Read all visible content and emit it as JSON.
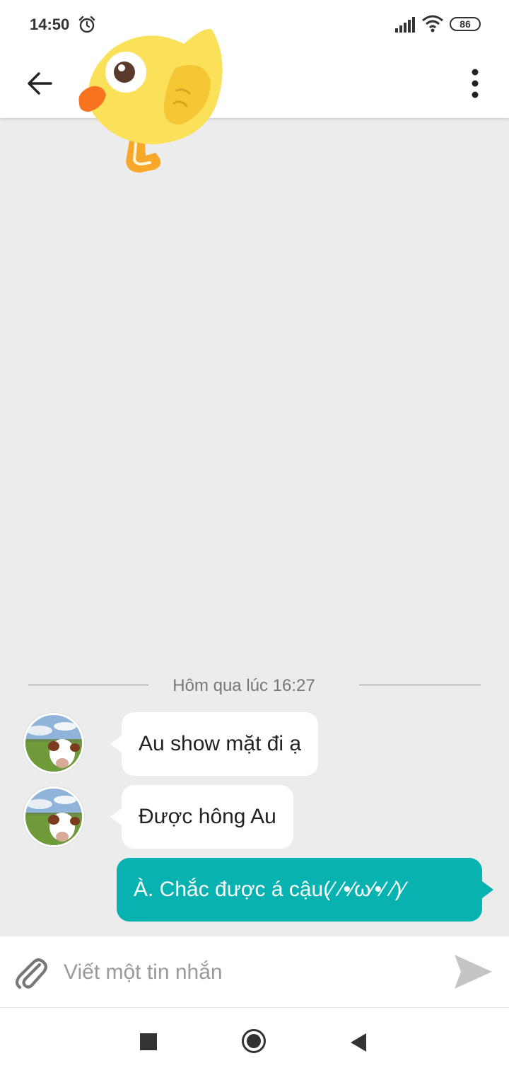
{
  "status_bar": {
    "time": "14:50",
    "battery": "86",
    "icons": [
      "alarm-icon",
      "signal-icon",
      "wifi-icon",
      "battery-icon"
    ]
  },
  "app_bar": {
    "icons": [
      "arrow-left-icon",
      "more-vertical-icon",
      "duck-mascot-icon"
    ]
  },
  "chat": {
    "date_divider": "Hôm qua lúc 16:27",
    "messages": [
      {
        "direction": "incoming",
        "text": "Au show mặt đi ạ"
      },
      {
        "direction": "incoming",
        "text": "Được hông Au"
      },
      {
        "direction": "outgoing",
        "text": "À. Chắc được á cậu(⁄ ⁄•⁄ω⁄•⁄ ⁄)⁄"
      }
    ]
  },
  "composer": {
    "placeholder": "Viết một tin nhắn",
    "value": "",
    "icons": [
      "paperclip-icon",
      "send-icon"
    ]
  },
  "colors": {
    "outgoing_bubble": "#08b2b0",
    "incoming_bubble": "#ffffff",
    "background": "#ececec"
  }
}
